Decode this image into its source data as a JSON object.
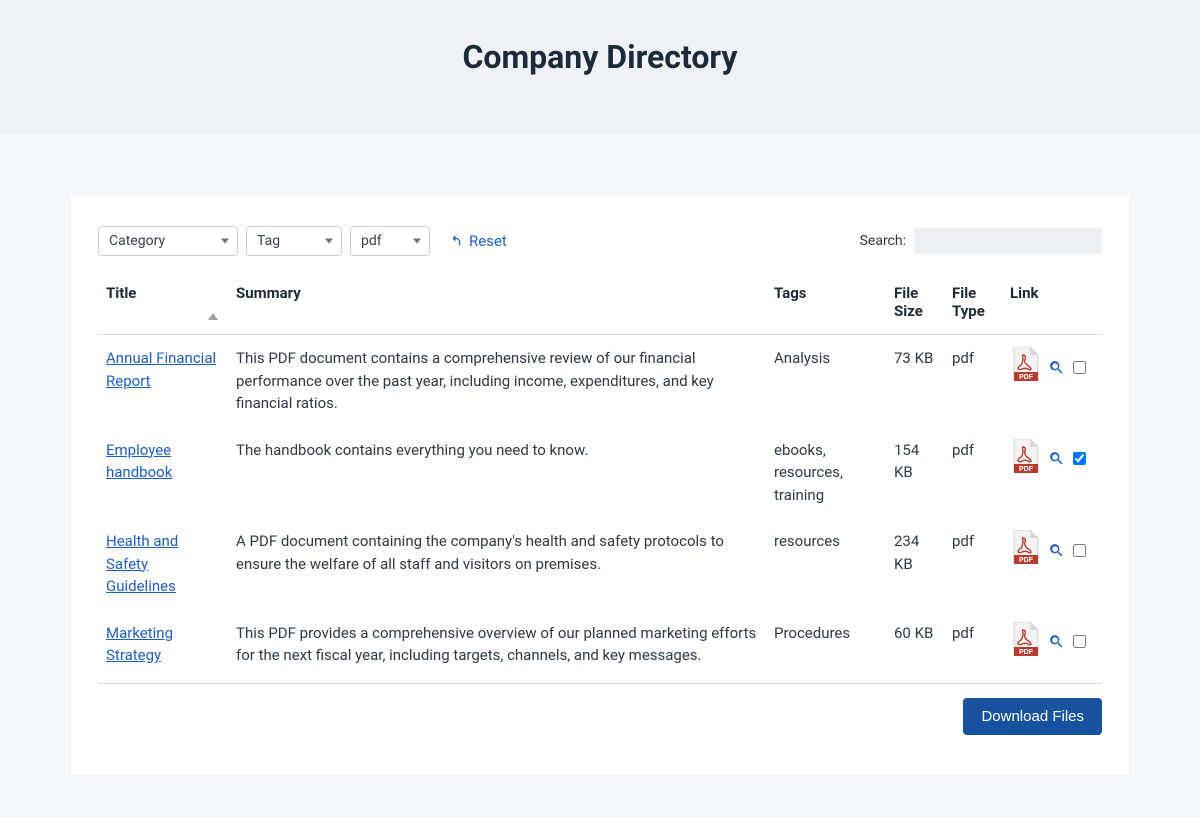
{
  "hero": {
    "title": "Company Directory"
  },
  "filters": {
    "category_label": "Category",
    "tag_label": "Tag",
    "type_value": "pdf",
    "reset_label": "Reset"
  },
  "search": {
    "label": "Search:",
    "value": ""
  },
  "columns": {
    "title": "Title",
    "summary": "Summary",
    "tags": "Tags",
    "file_size": "File Size",
    "file_type": "File Type",
    "link": "Link"
  },
  "rows": [
    {
      "title": "Annual Financial Report",
      "summary": "This PDF document contains a comprehensive review of our financial performance over the past year, including income, expenditures, and key financial ratios.",
      "tags": "Analysis",
      "file_size": "73 KB",
      "file_type": "pdf",
      "selected": false
    },
    {
      "title": "Employee handbook",
      "summary": "The handbook contains everything you need to know.",
      "tags": "ebooks, resources, training",
      "file_size": "154 KB",
      "file_type": "pdf",
      "selected": true
    },
    {
      "title": "Health and Safety Guidelines",
      "summary": "A PDF document containing the company's health and safety protocols to ensure the welfare of all staff and visitors on premises.",
      "tags": "resources",
      "file_size": "234 KB",
      "file_type": "pdf",
      "selected": false
    },
    {
      "title": "Marketing Strategy",
      "summary": "This PDF provides a comprehensive overview of our planned marketing efforts for the next fiscal year, including targets, channels, and key messages.",
      "tags": "Procedures",
      "file_size": "60 KB",
      "file_type": "pdf",
      "selected": false
    }
  ],
  "actions": {
    "download_label": "Download Files"
  }
}
